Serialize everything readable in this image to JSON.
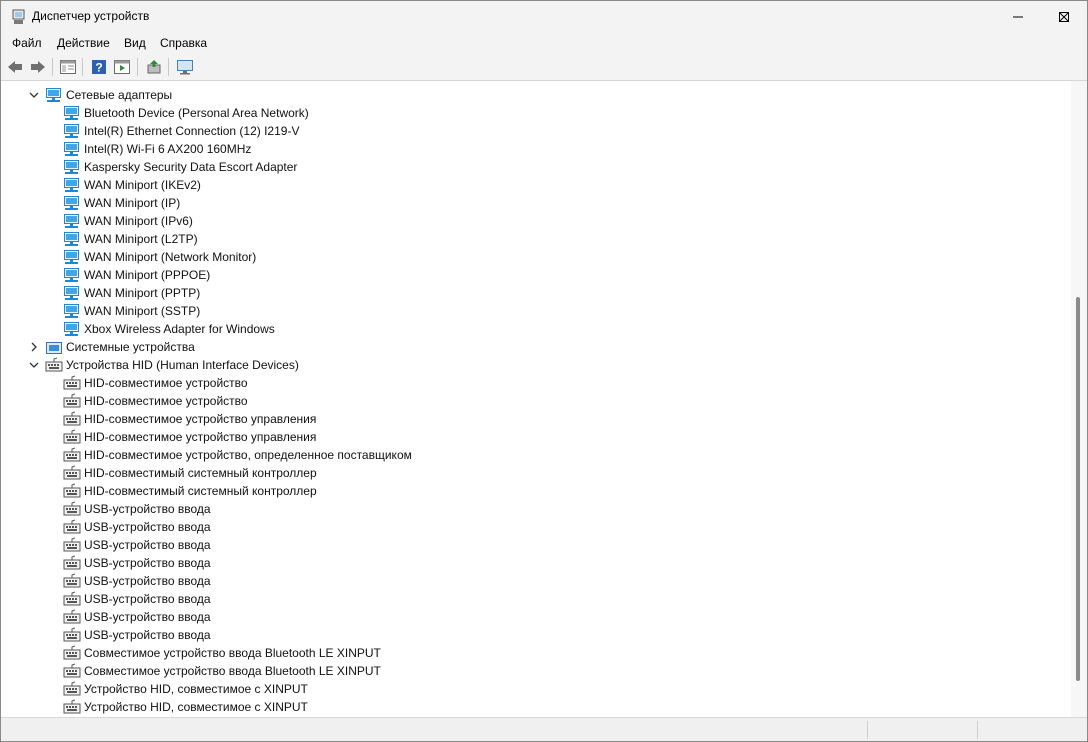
{
  "window": {
    "title": "Диспетчер устройств"
  },
  "menu": {
    "file": "Файл",
    "action": "Действие",
    "view": "Вид",
    "help": "Справка"
  },
  "toolbar": [
    "back-icon",
    "forward-icon",
    "show-hide-tree-icon",
    "help-icon",
    "properties-icon",
    "update-driver-icon",
    "scan-hardware-icon"
  ],
  "tree": {
    "network": {
      "label": "Сетевые адаптеры",
      "expanded": true,
      "items": [
        "Bluetooth Device (Personal Area Network)",
        "Intel(R) Ethernet Connection (12) I219-V",
        "Intel(R) Wi-Fi 6 AX200 160MHz",
        "Kaspersky Security Data Escort Adapter",
        "WAN Miniport (IKEv2)",
        "WAN Miniport (IP)",
        "WAN Miniport (IPv6)",
        "WAN Miniport (L2TP)",
        "WAN Miniport (Network Monitor)",
        "WAN Miniport (PPPOE)",
        "WAN Miniport (PPTP)",
        "WAN Miniport (SSTP)",
        "Xbox Wireless Adapter for Windows"
      ]
    },
    "system": {
      "label": "Системные устройства",
      "expanded": false
    },
    "hid": {
      "label": "Устройства HID (Human Interface Devices)",
      "expanded": true,
      "items": [
        "HID-совместимое устройство",
        "HID-совместимое устройство",
        "HID-совместимое устройство управления",
        "HID-совместимое устройство управления",
        "HID-совместимое устройство, определенное поставщиком",
        "HID-совместимый системный контроллер",
        "HID-совместимый системный контроллер",
        "USB-устройство ввода",
        "USB-устройство ввода",
        "USB-устройство ввода",
        "USB-устройство ввода",
        "USB-устройство ввода",
        "USB-устройство ввода",
        "USB-устройство ввода",
        "USB-устройство ввода",
        "Совместимое устройство ввода Bluetooth LE XINPUT",
        "Совместимое устройство ввода Bluetooth LE XINPUT",
        "Устройство HID, совместимое с XINPUT",
        "Устройство HID, совместимое с XINPUT"
      ]
    }
  },
  "colors": {
    "window_bg": "#f3f3f3",
    "tree_bg": "#ffffff",
    "network_icon": "#1e88d6",
    "hid_icon": "#555555"
  }
}
